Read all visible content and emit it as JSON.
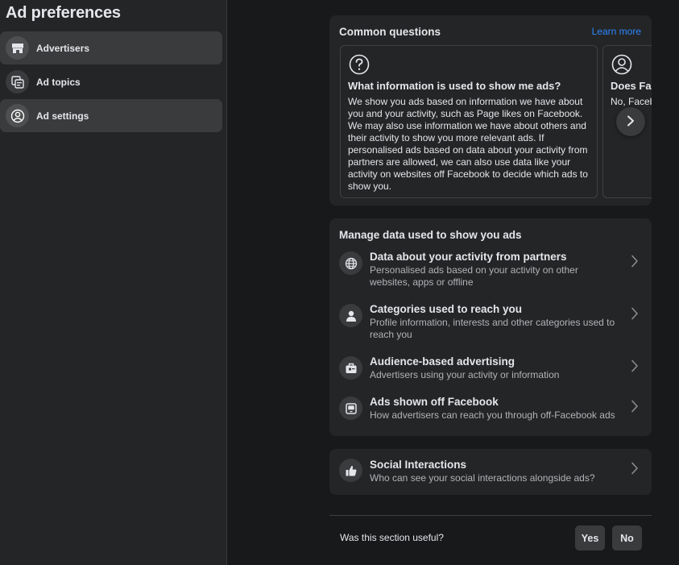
{
  "sidebar": {
    "title": "Ad preferences",
    "items": [
      {
        "label": "Advertisers",
        "icon": "storefront-icon"
      },
      {
        "label": "Ad topics",
        "icon": "ad-topics-icon"
      },
      {
        "label": "Ad settings",
        "icon": "person-settings-icon"
      }
    ]
  },
  "common_questions": {
    "title": "Common questions",
    "learn_more": "Learn more",
    "cards": [
      {
        "icon": "question-mark-icon",
        "title": "What information is used to show me ads?",
        "body": "We show you ads based on information we have about you and your activity, such as Page likes on Facebook. We may also use information we have about others and their activity to show you more relevant ads. If personalised ads based on data about your activity from partners are allowed, we can also use data like your activity on websites off Facebook to decide which ads to show you."
      },
      {
        "icon": "person-circle-icon",
        "title": "Does Fac",
        "body": "No, Faceb in ic F k"
      }
    ]
  },
  "manage_data": {
    "title": "Manage data used to show you ads",
    "rows": [
      {
        "icon": "globe-icon",
        "title": "Data about your activity from partners",
        "subtitle": "Personalised ads based on your activity on other websites, apps or offline"
      },
      {
        "icon": "person-icon",
        "title": "Categories used to reach you",
        "subtitle": "Profile information, interests and other categories used to reach you"
      },
      {
        "icon": "briefcase-icon",
        "title": "Audience-based advertising",
        "subtitle": "Advertisers using your activity or information"
      },
      {
        "icon": "tablet-icon",
        "title": "Ads shown off Facebook",
        "subtitle": "How advertisers can reach you through off-Facebook ads"
      }
    ]
  },
  "social": {
    "icon": "thumbs-up-icon",
    "title": "Social Interactions",
    "subtitle": "Who can see your social interactions alongside ads?"
  },
  "feedback": {
    "question": "Was this section useful?",
    "yes": "Yes",
    "no": "No"
  },
  "colors": {
    "background": "#18191a",
    "surface": "#242526",
    "accent": "#2d88ff",
    "text_primary": "#e4e6eb",
    "text_secondary": "#b0b3b8"
  }
}
